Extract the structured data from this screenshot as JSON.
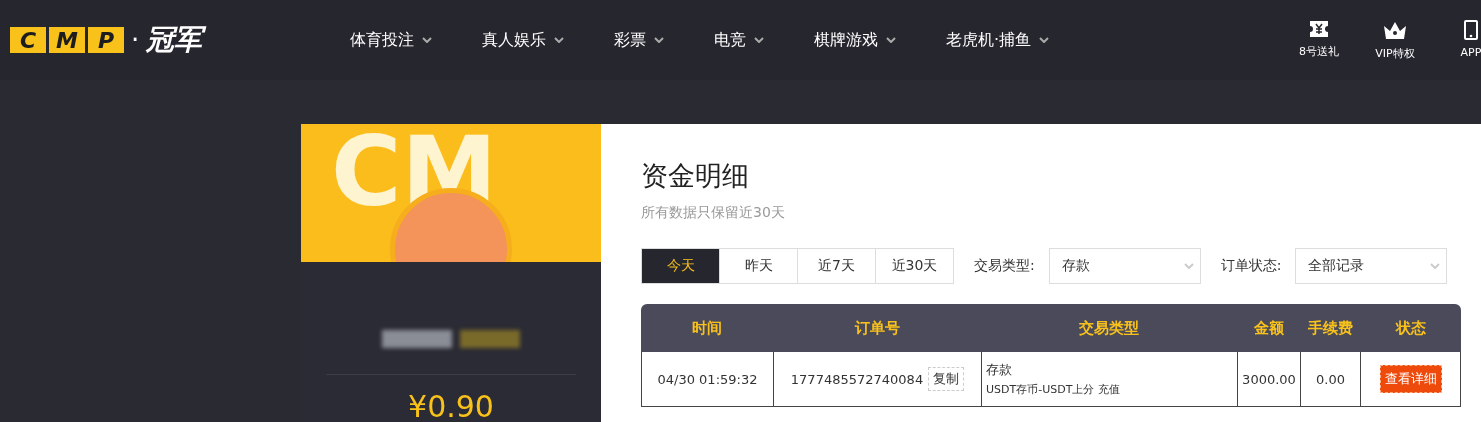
{
  "logo": {
    "letters": [
      "C",
      "M",
      "P"
    ],
    "dot": "·",
    "name": "冠军"
  },
  "nav": [
    {
      "label": "体育投注"
    },
    {
      "label": "真人娱乐"
    },
    {
      "label": "彩票"
    },
    {
      "label": "电竞"
    },
    {
      "label": "棋牌游戏"
    },
    {
      "label": "老虎机·捕鱼"
    }
  ],
  "header_links": [
    {
      "kind": "ticket",
      "label": "8号送礼"
    },
    {
      "kind": "crown",
      "label": "VIP特权"
    },
    {
      "kind": "phone",
      "label": "APP"
    }
  ],
  "profile": {
    "watermark": "CM",
    "balance": "¥0.90"
  },
  "page": {
    "title": "资金明细",
    "subtitle": "所有数据只保留近30天"
  },
  "date_tabs": [
    {
      "label": "今天",
      "selected": true
    },
    {
      "label": "昨天",
      "selected": false
    },
    {
      "label": "近7天",
      "selected": false
    },
    {
      "label": "近30天",
      "selected": false
    }
  ],
  "filters": [
    {
      "label": "交易类型:",
      "value": "存款"
    },
    {
      "label": "订单状态:",
      "value": "全部记录"
    }
  ],
  "table": {
    "columns": [
      "时间",
      "订单号",
      "交易类型",
      "金额",
      "手续费",
      "状态"
    ],
    "rows": [
      {
        "time": "04/30 01:59:32",
        "order_no": "1777485572740084",
        "copy": "复制",
        "type": "存款",
        "type_detail": "USDT存币-USDT上分 充值",
        "amount": "3000.00",
        "fee": "0.00",
        "action": "查看详细"
      }
    ]
  }
}
